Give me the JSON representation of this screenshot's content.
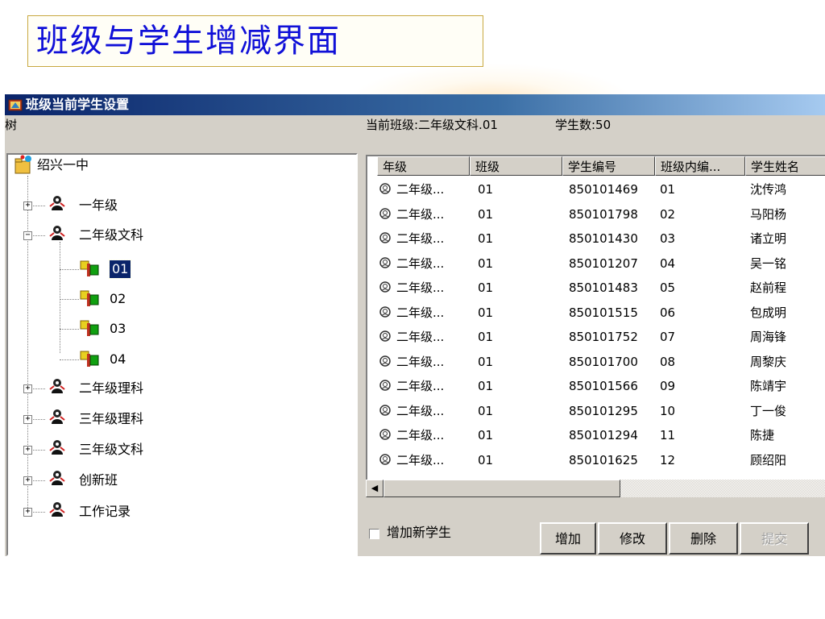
{
  "slide": {
    "title": "班级与学生增减界面"
  },
  "window": {
    "title": "班级当前学生设置",
    "icon": "app-icon",
    "title_bar_color": "#0a246a"
  },
  "left_pane": {
    "label": "树"
  },
  "right_pane": {
    "current_class": "当前班级:二年级文科.01",
    "student_count": "学生数:50"
  },
  "tree": {
    "root": "绍兴一中",
    "nodes": [
      {
        "label": "一年级",
        "expander": "+"
      },
      {
        "label": "二年级文科",
        "expander": "−"
      },
      {
        "label": "01",
        "selected": true
      },
      {
        "label": "02"
      },
      {
        "label": "03"
      },
      {
        "label": "04"
      },
      {
        "label": "二年级理科",
        "expander": "+"
      },
      {
        "label": "三年级理科",
        "expander": "+"
      },
      {
        "label": "三年级文科",
        "expander": "+"
      },
      {
        "label": "创新班",
        "expander": "+"
      },
      {
        "label": "工作记录",
        "expander": "+"
      }
    ]
  },
  "grid": {
    "columns": [
      "年级",
      "班级",
      "学生编号",
      "班级内编...",
      "学生姓名"
    ],
    "rows": [
      [
        "二年级...",
        "01",
        "850101469",
        "01",
        "沈传鸿"
      ],
      [
        "二年级...",
        "01",
        "850101798",
        "02",
        "马阳杨"
      ],
      [
        "二年级...",
        "01",
        "850101430",
        "03",
        "诸立明"
      ],
      [
        "二年级...",
        "01",
        "850101207",
        "04",
        "吴一铭"
      ],
      [
        "二年级...",
        "01",
        "850101483",
        "05",
        "赵前程"
      ],
      [
        "二年级...",
        "01",
        "850101515",
        "06",
        "包成明"
      ],
      [
        "二年级...",
        "01",
        "850101752",
        "07",
        "周海锋"
      ],
      [
        "二年级...",
        "01",
        "850101700",
        "08",
        "周黎庆"
      ],
      [
        "二年级...",
        "01",
        "850101566",
        "09",
        "陈靖宇"
      ],
      [
        "二年级...",
        "01",
        "850101295",
        "10",
        "丁一俊"
      ],
      [
        "二年级...",
        "01",
        "850101294",
        "11",
        "陈捷"
      ],
      [
        "二年级...",
        "01",
        "850101625",
        "12",
        "顾绍阳"
      ]
    ]
  },
  "controls": {
    "add_new_student": "增加新学生",
    "add_new_student_checked": false,
    "buttons": [
      {
        "label": "增加",
        "enabled": true
      },
      {
        "label": "修改",
        "enabled": true
      },
      {
        "label": "删除",
        "enabled": true
      },
      {
        "label": "提交",
        "enabled": false
      }
    ]
  }
}
